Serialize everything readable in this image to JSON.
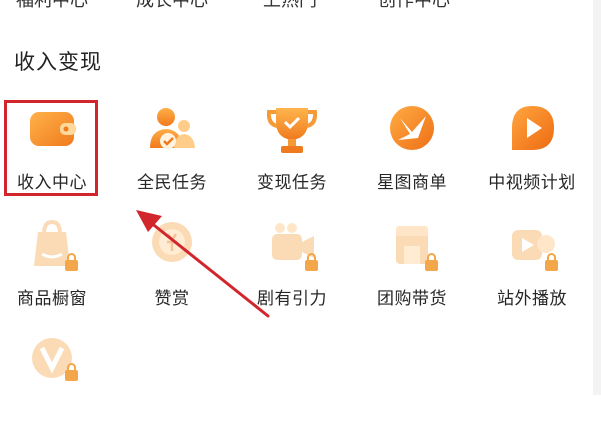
{
  "top_row": [
    "福利中心",
    "成长中心",
    "上热门",
    "创作中心"
  ],
  "section": {
    "title": "收入变现"
  },
  "items": [
    {
      "label": "收入中心",
      "icon": "wallet-icon"
    },
    {
      "label": "全民任务",
      "icon": "people-task-icon"
    },
    {
      "label": "变现任务",
      "icon": "trophy-icon"
    },
    {
      "label": "星图商单",
      "icon": "star-map-icon"
    },
    {
      "label": "中视频计划",
      "icon": "video-play-icon"
    },
    {
      "label": "商品橱窗",
      "icon": "shopping-bag-icon",
      "locked": true
    },
    {
      "label": "赞赏",
      "icon": "coin-reward-icon",
      "locked": true
    },
    {
      "label": "剧有引力",
      "icon": "drama-camera-icon",
      "locked": true
    },
    {
      "label": "团购带货",
      "icon": "group-buy-icon",
      "locked": true
    },
    {
      "label": "站外播放",
      "icon": "external-play-icon",
      "locked": true
    },
    {
      "label": "",
      "icon": "v-badge-icon",
      "locked": true
    }
  ],
  "colors": {
    "accent": "#f7952d",
    "highlight": "#d0262c",
    "arrow": "#d0262c"
  }
}
